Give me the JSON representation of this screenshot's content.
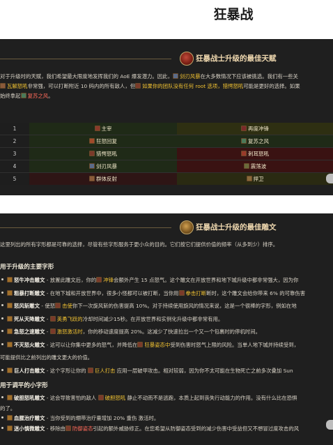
{
  "page": {
    "title": "狂暴战"
  },
  "talents": {
    "heading": "狂暴战士升级的最佳天赋",
    "intro": {
      "l1": "对于升级时的天赋，我们希望最大限度地发挥我们的 AoE 爆发潜力。因此，",
      "l1_hl": "剑刃风暴",
      "l1_end": "在大多数情况下应该被挑选。我们有一些关",
      "l2_hl1": "瓦解怒吼",
      "l2_mid": "非常强，可以打断附近 10 码内的所有敌人，但",
      "l2_hl2": "如果你的团队没有任何 root 选项，猎愕怒吼",
      "l2_end": "可能是更好的选择。如果",
      "l3": "始终拿起",
      "l3_hl": "复苏之风",
      "l3_end": "。"
    },
    "rows": [
      {
        "num": "1",
        "left": "主宰",
        "right": "再度冲锋",
        "left_color": "#1f2a17",
        "right_color": "#2e2f12"
      },
      {
        "num": "2",
        "left": "狂怒回复",
        "right": "复苏之风",
        "left_color": "#1f2a17",
        "right_color": "#1f2a17"
      },
      {
        "num": "3",
        "left": "猎愕怒吼",
        "right": "刺耳怒吼",
        "left_color": "#1f2a17",
        "right_color": "#3a1212"
      },
      {
        "num": "4",
        "left": "剑刃风暴",
        "right": "震荡波",
        "left_color": "#1f2a17",
        "right_color": "#3a1212"
      },
      {
        "num": "5",
        "left": "群体反射",
        "right": "捍卫",
        "left_color": "#2e1515",
        "right_color": "#2a2a12"
      }
    ]
  },
  "glyphs": {
    "heading": "狂暴战士升级的最佳雕文",
    "intro": "这里列出的所有字形都是可靠的选择，尽管有些字形服务于更小众的目的。它们按它们提供价值的频率（从多到少）排序。",
    "major_heading": "用于升级的主要字形",
    "major_items": [
      {
        "name": "怒牛冲击雕文",
        "text": " - 放置此雕文后，你的",
        "hl": "冲锋",
        "hl_class": "hl-yellow",
        "rest": "会额外产生 15 点怒气。这个雕文在开放世界和地下城升级中都非常强大，因为你"
      },
      {
        "name": "粗暴打断雕文",
        "text": " - 在地下城和开放世界中，很多小怪都可以被打断，当你用",
        "hl": "拳击打断",
        "hl_class": "hl-yellow",
        "rest": "断时，这个雕文会给你带来 6% 的可靠伤害"
      },
      {
        "name": "怒风斩雕文",
        "text": " - 使怒",
        "hl": "击使",
        "hl_class": "hl-yellow",
        "rest": "你下一次旋风斩的伤害提高 10%。对于持续使用旋风的情况来说，这是一个很棒的字形，例如在地"
      },
      {
        "name": "死从天降雕文",
        "text": " - ",
        "hl": "英勇飞跃的",
        "hl_class": "hl-yellow",
        "rest": "冷却时间减少15秒。在开放世界和实例化升级中都非常有用。"
      },
      {
        "name": "急怒之速雕文",
        "text": " - ",
        "hl": "激怒激活时",
        "hl_class": "hl-yellow",
        "rest": "，你的移动速度提高 20%。这减少了快速拉出一个又一个包裹时的停机时间。"
      },
      {
        "name": "不灭怒火雕文",
        "text": " - 这可以让你集中更多的怒气，并降低在",
        "hl": "狂暴姿态中",
        "hl_class": "hl-yellow",
        "rest": "受到伤害时怒气上限的风险。当单人地下城并持续受到，"
      },
      {
        "name": "",
        "text": "可能提供比之前列出的雕文更大的价值。",
        "hl": "",
        "hl_class": "",
        "rest": ""
      },
      {
        "name": "巨人打击雕文",
        "text": " - 这个字形让你的 ",
        "hl": "巨人打击",
        "hl_class": "hl-yellow",
        "rest": " 应用一层破甲攻击。相对较弱，因为你不太可能在生物死亡之前多次叠加 Sun"
      }
    ],
    "minor_heading": "用于调平的小字形",
    "minor_items": [
      {
        "name": "破胆怒吼雕文",
        "text": " - 这会导致害怕的敌人 ",
        "hl": "破胆怒吼",
        "hl_class": "hl-yellow",
        "rest": " 静止不动而不是逃跑，本质上起到丧失行动能力的作用。没有什么比在恐惧"
      },
      {
        "name": "",
        "text": "的了。",
        "hl": "",
        "hl_class": "",
        "rest": ""
      },
      {
        "name": "血腥治疗雕文",
        "text": " - 当你受到",
        "hl": "",
        "hl_class": "",
        "rest": "的绷带治疗量增加 20% 重伤 激活时。"
      },
      {
        "name": "迷小慎微雕文",
        "text": " - 移除由",
        "hl": "防御姿态",
        "hl_class": "hl-red",
        "rest": "引起的额外威胁修正。在您希望从防御姿态受到的减少伤害中受益但又不想冒过度攻击的风"
      }
    ]
  },
  "colors": {
    "panel_bg": "#1f1f1f",
    "accent": "#f1c232",
    "heading": "#f0d9b0"
  },
  "icons": [
    "emblem-icon",
    "ability-icon",
    "scroll-knob"
  ]
}
